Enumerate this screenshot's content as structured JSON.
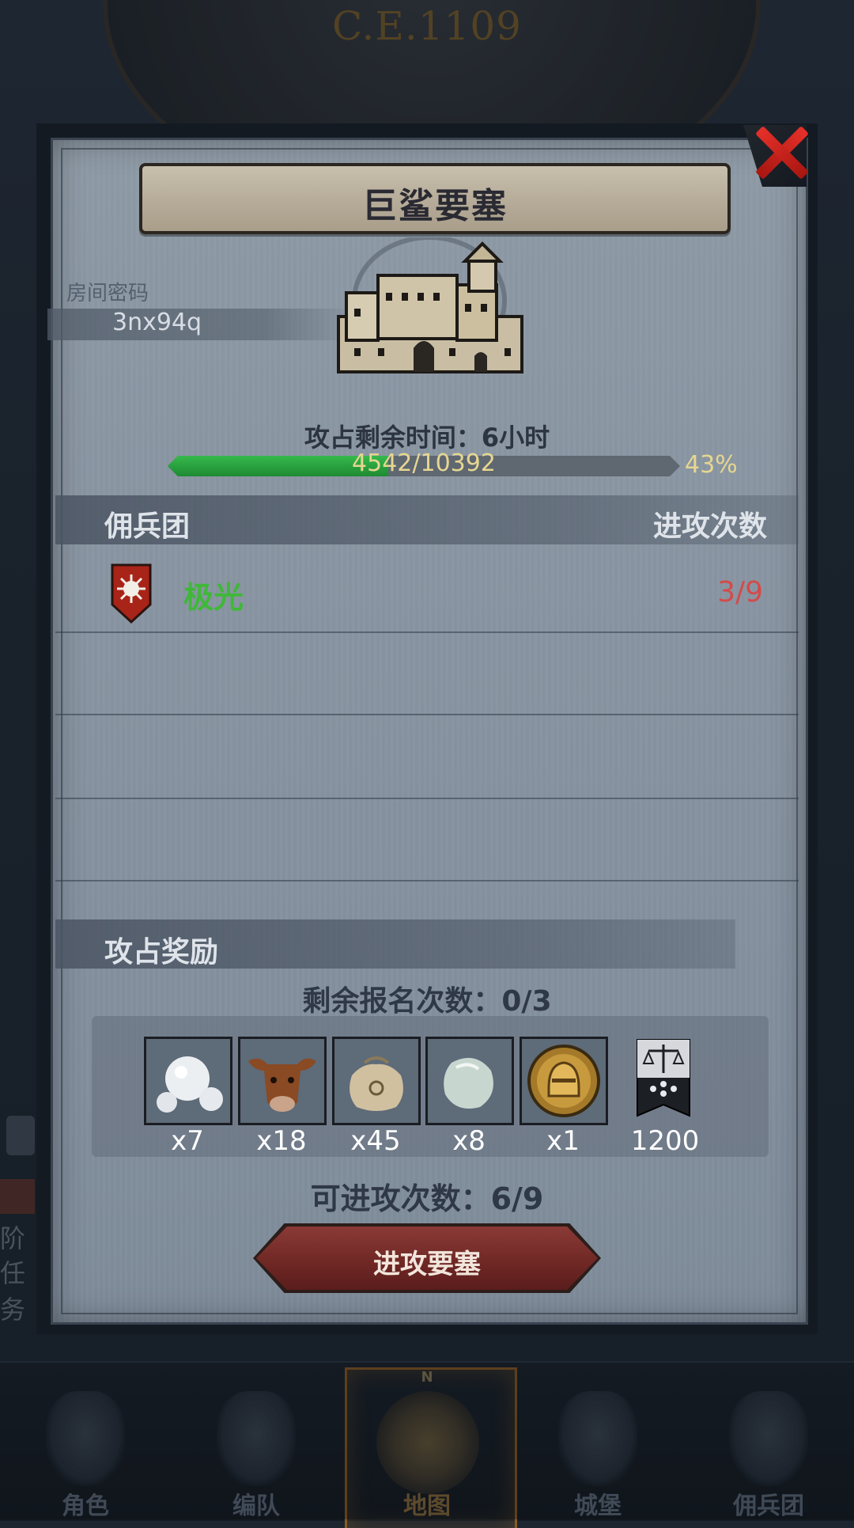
{
  "background": {
    "era": "C.E.1109",
    "side_fragments": [
      "阶",
      "任务"
    ]
  },
  "modal": {
    "title": "巨鲨要塞",
    "room_password_label": "房间密码",
    "room_password": "3nx94q",
    "conquer_time_text": "攻占剩余时间：6小时",
    "progress": {
      "current": 4542,
      "total": 10392,
      "text": "4542/10392",
      "percent_text": "43%",
      "fraction": 0.43
    },
    "mercenary_section": {
      "left_header": "佣兵团",
      "right_header": "进攻次数"
    },
    "mercenaries": [
      {
        "name": "极光",
        "attacks": "3/9",
        "color": "#3fb838"
      }
    ],
    "reward_section": {
      "header": "攻占奖励"
    },
    "signup_remaining": "剩余报名次数：0/3",
    "rewards": [
      {
        "icon": "pearl-icon",
        "qty": "x7"
      },
      {
        "icon": "bull-head-icon",
        "qty": "x18"
      },
      {
        "icon": "sack-icon",
        "qty": "x45"
      },
      {
        "icon": "gem-stone-icon",
        "qty": "x8"
      },
      {
        "icon": "knight-helmet-medal-icon",
        "qty": "x1"
      },
      {
        "icon": "scales-banner-icon",
        "qty": "1200"
      }
    ],
    "attackable_count": "可进攻次数：6/9",
    "attack_button": "进攻要塞"
  },
  "bottom_nav": {
    "items": [
      {
        "label": "角色",
        "icon": "knight-icon"
      },
      {
        "label": "编队",
        "icon": "helmet-icon"
      },
      {
        "label": "地图",
        "icon": "compass-icon",
        "active": true,
        "compass_mark": "N"
      },
      {
        "label": "城堡",
        "icon": "castle-icon"
      },
      {
        "label": "佣兵团",
        "icon": "banner-icon"
      }
    ]
  },
  "colors": {
    "progress_fill": "#2aa040",
    "attacks_count": "#d44a4a",
    "close_x": "#d81f18",
    "attack_button": "#7a2f2c"
  }
}
